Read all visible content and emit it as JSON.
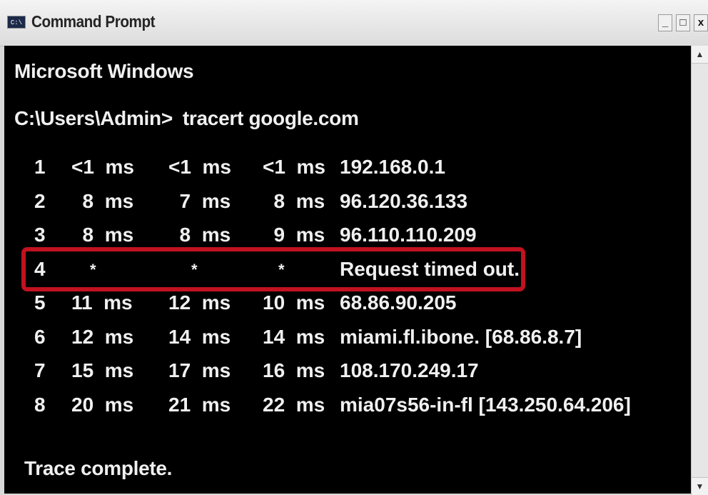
{
  "window": {
    "title": "Command Prompt",
    "icon_name": "console-app-icon",
    "icon_glyph": "C:\\",
    "controls": {
      "minimize": "_",
      "maximize": "□",
      "close": "x"
    }
  },
  "console": {
    "banner": "Microsoft Windows",
    "prompt": "C:\\Users\\Admin>",
    "command": "tracert google.com",
    "hops": [
      {
        "num": "1",
        "t1": "<1  ms",
        "t2": "<1  ms",
        "t3": "<1  ms",
        "host": "192.168.0.1"
      },
      {
        "num": "2",
        "t1": "  8  ms",
        "t2": "  7  ms",
        "t3": "  8  ms",
        "host": "96.120.36.133"
      },
      {
        "num": "3",
        "t1": "  8  ms",
        "t2": "  8  ms",
        "t3": "  9  ms",
        "host": "96.110.110.209"
      },
      {
        "num": "4",
        "t1": "*",
        "t2": "*",
        "t3": "*",
        "host": "Request timed out."
      },
      {
        "num": "5",
        "t1": "11  ms",
        "t2": "12  ms",
        "t3": "10  ms",
        "host": "68.86.90.205"
      },
      {
        "num": "6",
        "t1": "12  ms",
        "t2": "14  ms",
        "t3": "14  ms",
        "host": "miami.fl.ibone. [68.86.8.7]"
      },
      {
        "num": "7",
        "t1": "15  ms",
        "t2": "17  ms",
        "t3": "16  ms",
        "host": "108.170.249.17"
      },
      {
        "num": "8",
        "t1": "20  ms",
        "t2": "21  ms",
        "t3": "22  ms",
        "host": "mia07s56-in-fl [143.250.64.206]"
      }
    ],
    "footer": "Trace complete.",
    "highlight_color": "#c1121f",
    "background_color": "#000000",
    "text_color": "#f0f0f0"
  },
  "scrollbar": {
    "up_glyph": "▲",
    "down_glyph": "▼"
  }
}
